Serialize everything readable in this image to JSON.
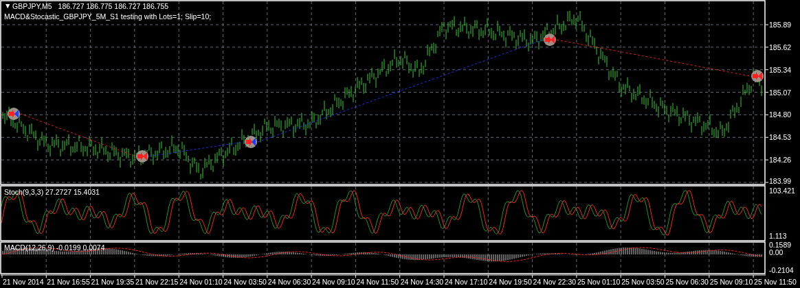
{
  "header": {
    "toggle": "▼",
    "symbol": "GBPJPY,M5",
    "prices": "186.727 186.775 186.727 186.755"
  },
  "expert_label": "MACD&Stocastic_GBPJPY_5M_S1 testing with Lots=1; Slip=10;",
  "price_axis_labels": [
    "185.89",
    "185.62",
    "185.34",
    "185.07",
    "184.80",
    "184.53",
    "184.26",
    "183.99"
  ],
  "stochastic": {
    "label": "Stoch(9,3,3) 27.2727 15.4031",
    "axis_labels": [
      "103.421",
      "1.113"
    ]
  },
  "macd": {
    "label": "MACD(12,26,9) -0.0199 0.0074",
    "axis_labels": [
      "0.1589",
      "0.00",
      "-0.2104"
    ]
  },
  "time_axis_labels": [
    "21 Nov 2014",
    "21 Nov 16:55",
    "21 Nov 19:35",
    "21 Nov 22:15",
    "24 Nov 01:10",
    "24 Nov 03:50",
    "24 Nov 06:30",
    "24 Nov 09:10",
    "24 Nov 11:50",
    "24 Nov 14:30",
    "24 Nov 17:10",
    "24 Nov 19:50",
    "24 Nov 22:30",
    "25 Nov 01:10",
    "25 Nov 03:50",
    "25 Nov 06:30",
    "25 Nov 09:10",
    "25 Nov 11:50"
  ]
}
